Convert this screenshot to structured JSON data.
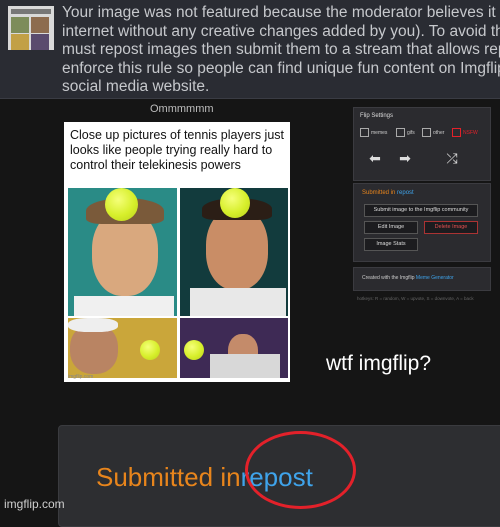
{
  "notice": {
    "text": "Your image was not featured because the moderator believes it is a repost\ninternet without any creative changes added by you). To avoid this, create y\nmust repost images then submit them to a stream that allows reposts such\nenforce this rule so people can find unique fun content on Imgflip instead of\nsocial media website."
  },
  "page": {
    "title_above_meme": "Ommmmmm",
    "meme_caption": "Close up pictures of tennis players just looks like people trying really hard to control their telekinesis powers",
    "meme_watermark": "imgflip.com"
  },
  "flip_settings": {
    "title": "Flip Settings",
    "options": [
      "memes",
      "gifs",
      "other",
      "NSFW"
    ],
    "controls": [
      "prev-arrow",
      "next-arrow",
      "shuffle"
    ]
  },
  "submitted": {
    "prefix": "Submitted in",
    "stream": "repost",
    "buttons": {
      "submit": "Submit image to the Imgflip community",
      "edit": "Edit Image",
      "delete": "Delete Image",
      "stats": "Image Stats"
    }
  },
  "created": {
    "prefix": "Created with the Imgflip",
    "link": "Meme Generator"
  },
  "hotkeys": "hotkeys: R = random, W = upvote, S = downvote, A = back",
  "overlay_text": "wtf imgflip?",
  "zoom": {
    "submitted": "Submitted",
    "in": "in",
    "repost": "repost"
  },
  "footer_watermark": "imgflip.com",
  "colors": {
    "orange": "#e8851c",
    "blue": "#3fa3ea",
    "red": "#e3212a"
  }
}
